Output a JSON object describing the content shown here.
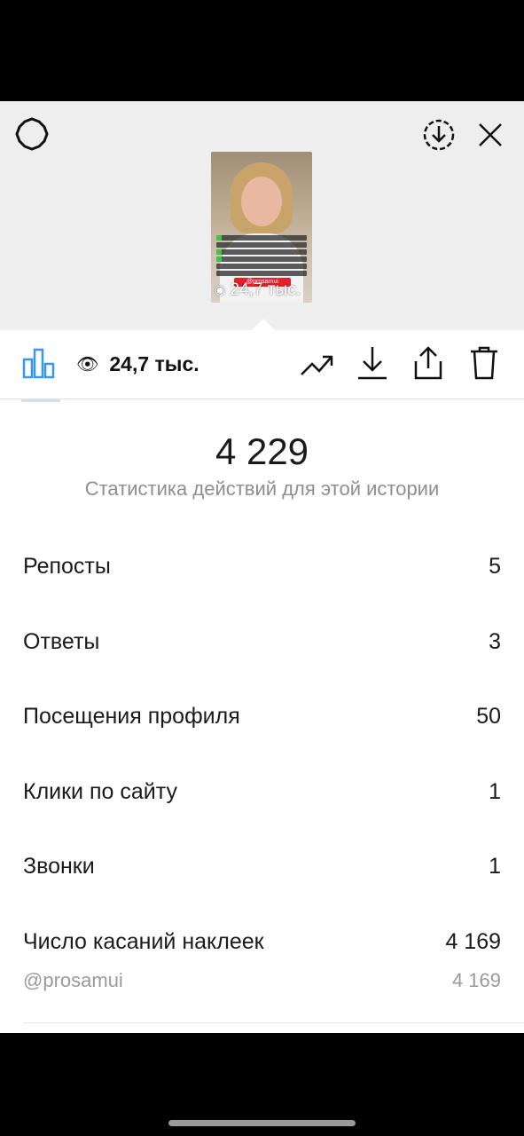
{
  "header": {
    "settings_icon": "gear-icon",
    "save_icon": "download-circle-icon",
    "close_icon": "close-icon"
  },
  "thumbnail": {
    "views": "24,7 тыс.",
    "tag": "@prosamui"
  },
  "toolbar": {
    "views": "24,7 тыс.",
    "icons": [
      "bar-chart-icon",
      "eye-icon",
      "trending-up-icon",
      "download-icon",
      "share-icon",
      "trash-icon"
    ]
  },
  "summary": {
    "total": "4 229",
    "caption": "Статистика действий для этой истории"
  },
  "metrics": [
    {
      "label": "Репосты",
      "value": "5"
    },
    {
      "label": "Ответы",
      "value": "3"
    },
    {
      "label": "Посещения профиля",
      "value": "50"
    },
    {
      "label": "Клики по сайту",
      "value": "1"
    },
    {
      "label": "Звонки",
      "value": "1"
    },
    {
      "label": "Число касаний наклеек",
      "value": "4 169"
    }
  ],
  "sticker": {
    "label": "@prosamui",
    "value": "4 169"
  },
  "colors": {
    "accent": "#3897f0",
    "header_bg": "#eeeeee",
    "muted": "#8e8e8e"
  }
}
